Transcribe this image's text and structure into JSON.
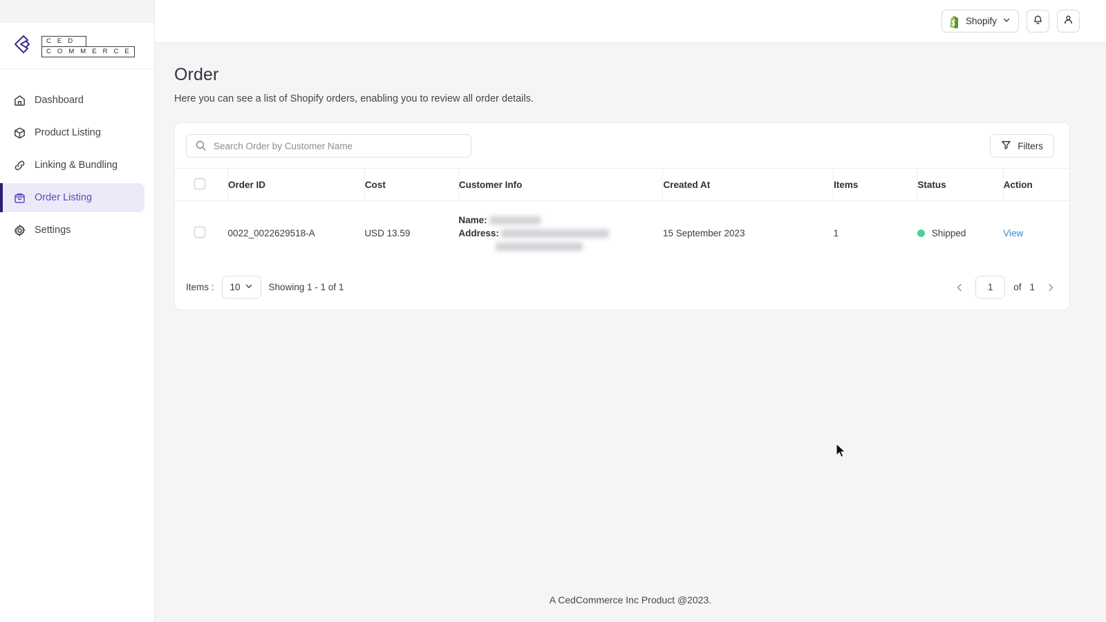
{
  "brand": {
    "logo_top": "C E D",
    "logo_bottom": "C O M M E R C E",
    "accent": "#5b4bc4",
    "accent_bar": "#2b1f74"
  },
  "sidebar": {
    "items": [
      {
        "label": "Dashboard",
        "icon": "home-icon",
        "active": false
      },
      {
        "label": "Product Listing",
        "icon": "cube-icon",
        "active": false
      },
      {
        "label": "Linking & Bundling",
        "icon": "link-icon",
        "active": false
      },
      {
        "label": "Order Listing",
        "icon": "bag-icon",
        "active": true
      },
      {
        "label": "Settings",
        "icon": "gear-icon",
        "active": false
      }
    ]
  },
  "topbar": {
    "store_name": "Shopify",
    "store_icon": "shopify-bag-icon",
    "chevron_icon": "chevron-down-icon",
    "notification_icon": "bell-icon",
    "account_icon": "user-icon"
  },
  "page": {
    "title": "Order",
    "subtitle": "Here you can see a list of Shopify orders, enabling you to review all order details."
  },
  "toolbar": {
    "search_placeholder": "Search Order by Customer Name",
    "search_value": "",
    "search_icon": "search-icon",
    "filters_label": "Filters",
    "filters_icon": "funnel-icon"
  },
  "table": {
    "columns": [
      "Order ID",
      "Cost",
      "Customer Info",
      "Created At",
      "Items",
      "Status",
      "Action"
    ],
    "rows": [
      {
        "order_id": "0022_0022629518-A",
        "cost": "USD 13.59",
        "customer_name_label": "Name:",
        "customer_name_value": "",
        "customer_address_label": "Address:",
        "customer_address_value": "",
        "created_at": "15 September 2023",
        "items": "1",
        "status": "Shipped",
        "status_color": "#45d297",
        "action": "View"
      }
    ]
  },
  "pagination": {
    "items_label": "Items :",
    "per_page": "10",
    "showing": "Showing 1 - 1 of 1",
    "prev_icon": "chevron-left-icon",
    "next_icon": "chevron-right-icon",
    "current_page": "1",
    "of_label": "of",
    "total_pages": "1"
  },
  "footer": {
    "note": "A CedCommerce Inc Product @2023."
  }
}
